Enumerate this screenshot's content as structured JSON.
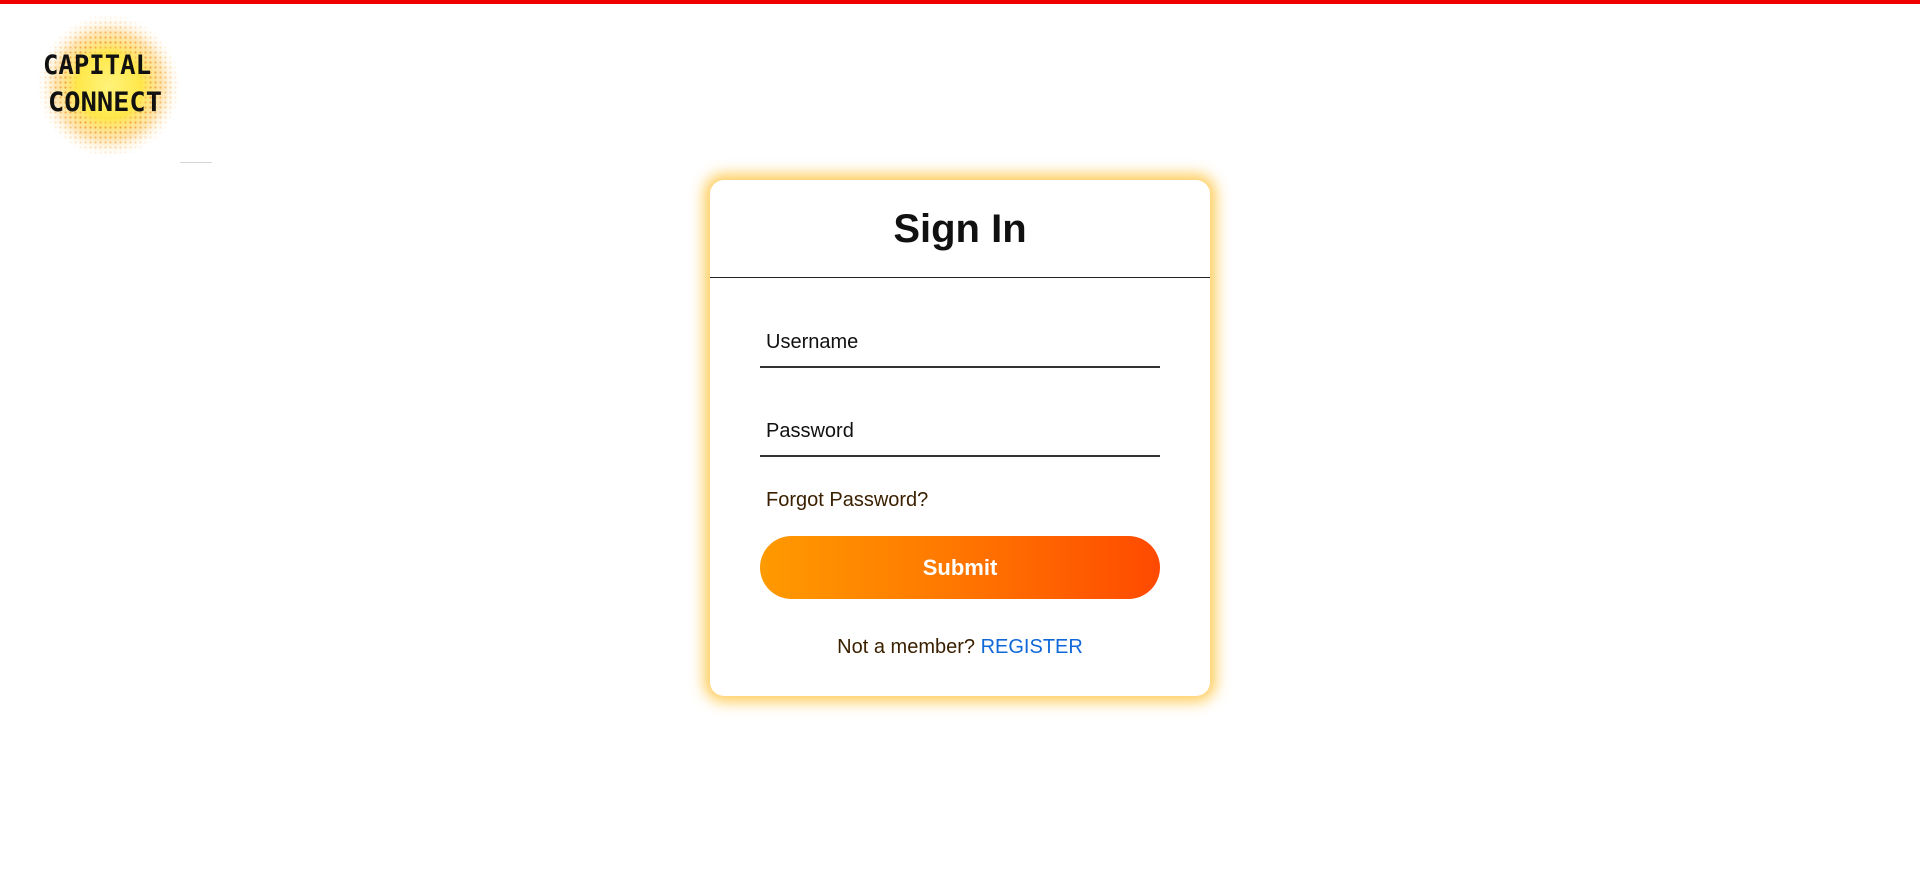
{
  "logo": {
    "line1": "CAPITAL",
    "line2": "CONNECT",
    "colors": {
      "glow": "#ffe84a",
      "dots": "#f3a43a"
    }
  },
  "colors": {
    "top_bar": "#ee0000",
    "card_glow": "#ffc440",
    "submit_gradient": [
      "#ff9a00",
      "#ff4a00"
    ],
    "link": "#1068d8"
  },
  "signin": {
    "title": "Sign In",
    "username_placeholder": "Username",
    "username_value": "",
    "password_placeholder": "Password",
    "password_value": "",
    "forgot_label": "Forgot Password?",
    "submit_label": "Submit",
    "not_member_text": "Not a member?",
    "register_label": "REGISTER"
  }
}
